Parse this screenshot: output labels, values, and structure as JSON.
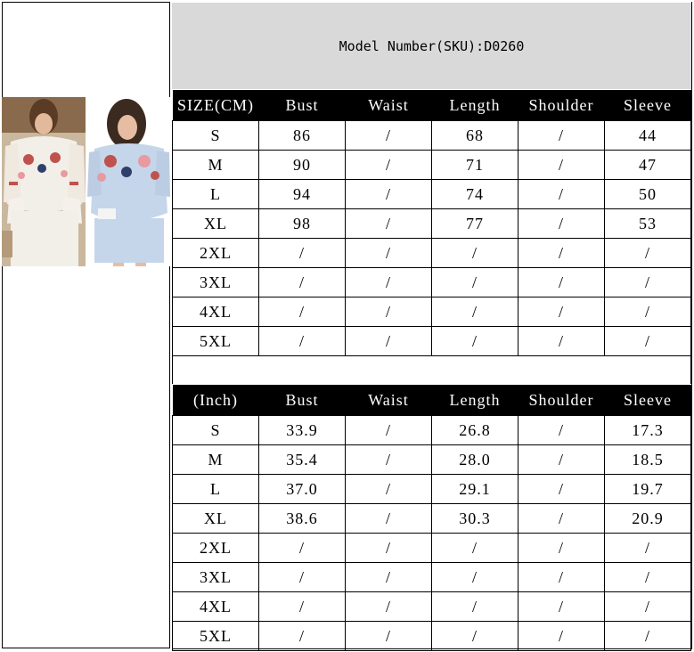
{
  "sku_header": "Model Number(SKU):D0260",
  "cm_table": {
    "headers": [
      "SIZE(CM)",
      "Bust",
      "Waist",
      "Length",
      "Shoulder",
      "Sleeve"
    ],
    "rows": [
      [
        "S",
        "86",
        "/",
        "68",
        "/",
        "44"
      ],
      [
        "M",
        "90",
        "/",
        "71",
        "/",
        "47"
      ],
      [
        "L",
        "94",
        "/",
        "74",
        "/",
        "50"
      ],
      [
        "XL",
        "98",
        "/",
        "77",
        "/",
        "53"
      ],
      [
        "2XL",
        "/",
        "/",
        "/",
        "/",
        "/"
      ],
      [
        "3XL",
        "/",
        "/",
        "/",
        "/",
        "/"
      ],
      [
        "4XL",
        "/",
        "/",
        "/",
        "/",
        "/"
      ],
      [
        "5XL",
        "/",
        "/",
        "/",
        "/",
        "/"
      ]
    ]
  },
  "inch_table": {
    "headers": [
      "(Inch)",
      "Bust",
      "Waist",
      "Length",
      "Shoulder",
      "Sleeve"
    ],
    "rows": [
      [
        "S",
        "33.9",
        "/",
        "26.8",
        "/",
        "17.3"
      ],
      [
        "M",
        "35.4",
        "/",
        "28.0",
        "/",
        "18.5"
      ],
      [
        "L",
        "37.0",
        "/",
        "29.1",
        "/",
        "19.7"
      ],
      [
        "XL",
        "38.6",
        "/",
        "30.3",
        "/",
        "20.9"
      ],
      [
        "2XL",
        "/",
        "/",
        "/",
        "/",
        "/"
      ],
      [
        "3XL",
        "/",
        "/",
        "/",
        "/",
        "/"
      ],
      [
        "4XL",
        "/",
        "/",
        "/",
        "/",
        "/"
      ],
      [
        "5XL",
        "/",
        "/",
        "/",
        "/",
        "/"
      ]
    ]
  },
  "colors": {
    "header_bg": "#000000",
    "header_text": "#ffffff",
    "sku_bg": "#d9d9d9",
    "dress_white": "#f2efe9",
    "dress_blue": "#c6d6ea",
    "embroidery_red": "#c0524e",
    "embroidery_pink": "#e79aa0",
    "embroidery_navy": "#2f3f6a"
  }
}
